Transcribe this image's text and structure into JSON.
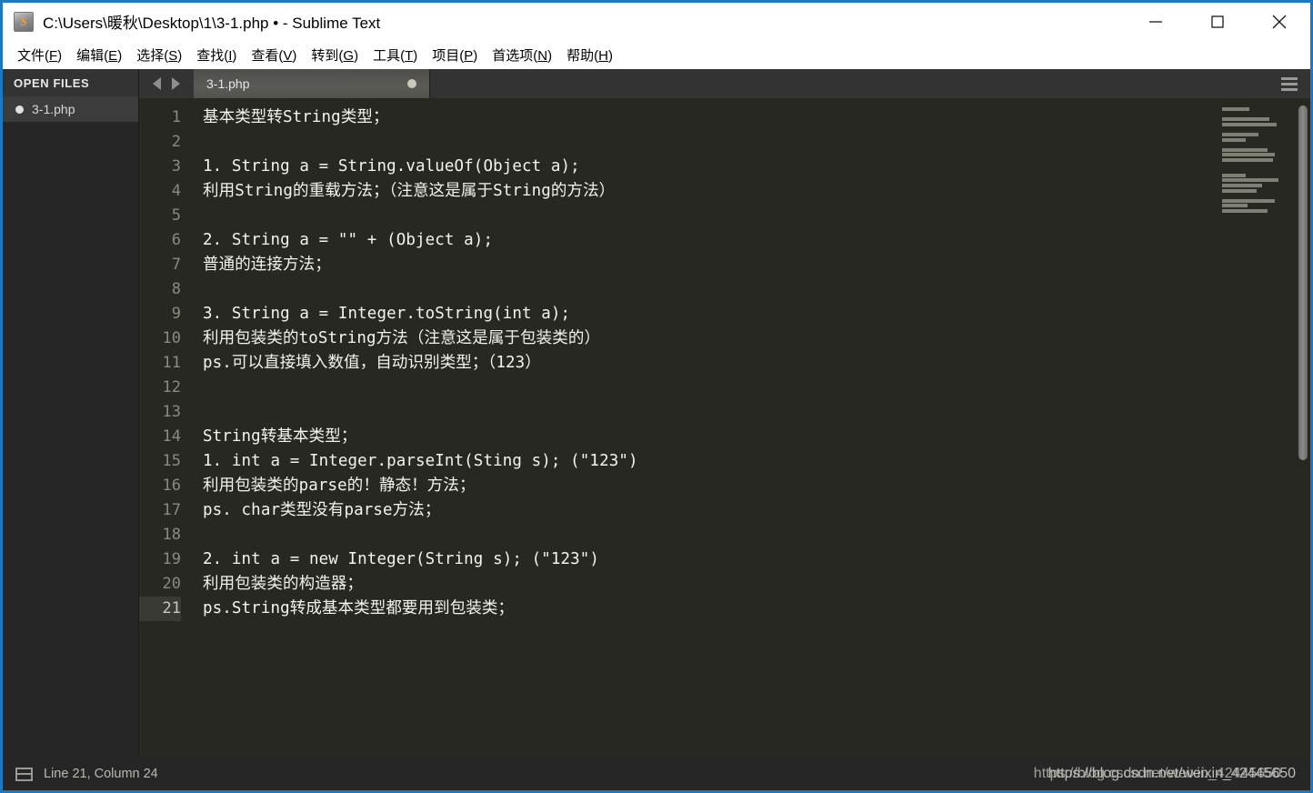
{
  "window": {
    "title": "C:\\Users\\暖秋\\Desktop\\1\\3-1.php • - Sublime Text",
    "icon_glyph": "S",
    "accent_border": "#1b79c4",
    "minimize_label": "Minimize",
    "maximize_label": "Maximize",
    "close_label": "Close"
  },
  "menubar": {
    "items": [
      {
        "label": "文件(F)",
        "text": "文件(",
        "accel": "F",
        "tail": ")"
      },
      {
        "label": "编辑(E)",
        "text": "编辑(",
        "accel": "E",
        "tail": ")"
      },
      {
        "label": "选择(S)",
        "text": "选择(",
        "accel": "S",
        "tail": ")"
      },
      {
        "label": "查找(I)",
        "text": "查找(",
        "accel": "I",
        "tail": ")"
      },
      {
        "label": "查看(V)",
        "text": "查看(",
        "accel": "V",
        "tail": ")"
      },
      {
        "label": "转到(G)",
        "text": "转到(",
        "accel": "G",
        "tail": ")"
      },
      {
        "label": "工具(T)",
        "text": "工具(",
        "accel": "T",
        "tail": ")"
      },
      {
        "label": "项目(P)",
        "text": "项目(",
        "accel": "P",
        "tail": ")"
      },
      {
        "label": "首选项(N)",
        "text": "首选项(",
        "accel": "N",
        "tail": ")"
      },
      {
        "label": "帮助(H)",
        "text": "帮助(",
        "accel": "H",
        "tail": ")"
      }
    ]
  },
  "sidebar": {
    "header": "OPEN FILES",
    "files": [
      {
        "name": "3-1.php",
        "dirty": true,
        "selected": true
      }
    ]
  },
  "tabbar": {
    "prev_label": "◀",
    "next_label": "▶",
    "menu_label": "≡",
    "tabs": [
      {
        "label": "3-1.php",
        "dirty": true,
        "active": true
      }
    ]
  },
  "editor": {
    "active_line": 21,
    "lines": [
      {
        "n": 1,
        "text": "基本类型转String类型；"
      },
      {
        "n": 2,
        "text": ""
      },
      {
        "n": 3,
        "text": "1. String a = String.valueOf(Object a);"
      },
      {
        "n": 4,
        "text": "利用String的重载方法；（注意这是属于String的方法）"
      },
      {
        "n": 5,
        "text": ""
      },
      {
        "n": 6,
        "text": "2. String a = \"\" + (Object a);"
      },
      {
        "n": 7,
        "text": "普通的连接方法；"
      },
      {
        "n": 8,
        "text": ""
      },
      {
        "n": 9,
        "text": "3. String a = Integer.toString(int a);"
      },
      {
        "n": 10,
        "text": "利用包装类的toString方法（注意这是属于包装类的）"
      },
      {
        "n": 11,
        "text": "ps.可以直接填入数值，自动识别类型；（123）"
      },
      {
        "n": 12,
        "text": ""
      },
      {
        "n": 13,
        "text": ""
      },
      {
        "n": 14,
        "text": "String转基本类型；"
      },
      {
        "n": 15,
        "text": "1. int a = Integer.parseInt(Sting s); (\"123\")"
      },
      {
        "n": 16,
        "text": "利用包装类的parse的！静态！方法；"
      },
      {
        "n": 17,
        "text": "ps. char类型没有parse方法；"
      },
      {
        "n": 18,
        "text": ""
      },
      {
        "n": 19,
        "text": "2. int a = new Integer(String s); (\"123\")"
      },
      {
        "n": 20,
        "text": "利用包装类的构造器；"
      },
      {
        "n": 21,
        "text": "ps.String转成基本类型都要用到包装类；"
      }
    ]
  },
  "minimap": {
    "line_widths": [
      30,
      0,
      52,
      60,
      0,
      40,
      26,
      0,
      50,
      58,
      56,
      0,
      0,
      26,
      62,
      44,
      38,
      0,
      58,
      28,
      50
    ]
  },
  "statusbar": {
    "layout_icon": "split-panel-icon",
    "position_text": "Line 21, Column 24",
    "watermark": "https://blog.csdn.net/weixin_42445650"
  },
  "colors": {
    "window_border": "#1b79c4",
    "titlebar_bg": "#ffffff",
    "menubar_bg": "#ffffff",
    "sidebar_bg": "#262626",
    "sidebar_header_bg": "#333333",
    "editor_bg": "#272822",
    "tab_active_bg": "#55554f",
    "tabbar_bg": "#333333",
    "statusbar_bg": "#262626",
    "code_fg": "#f4f4ef",
    "gutter_fg": "#8a8a80"
  }
}
